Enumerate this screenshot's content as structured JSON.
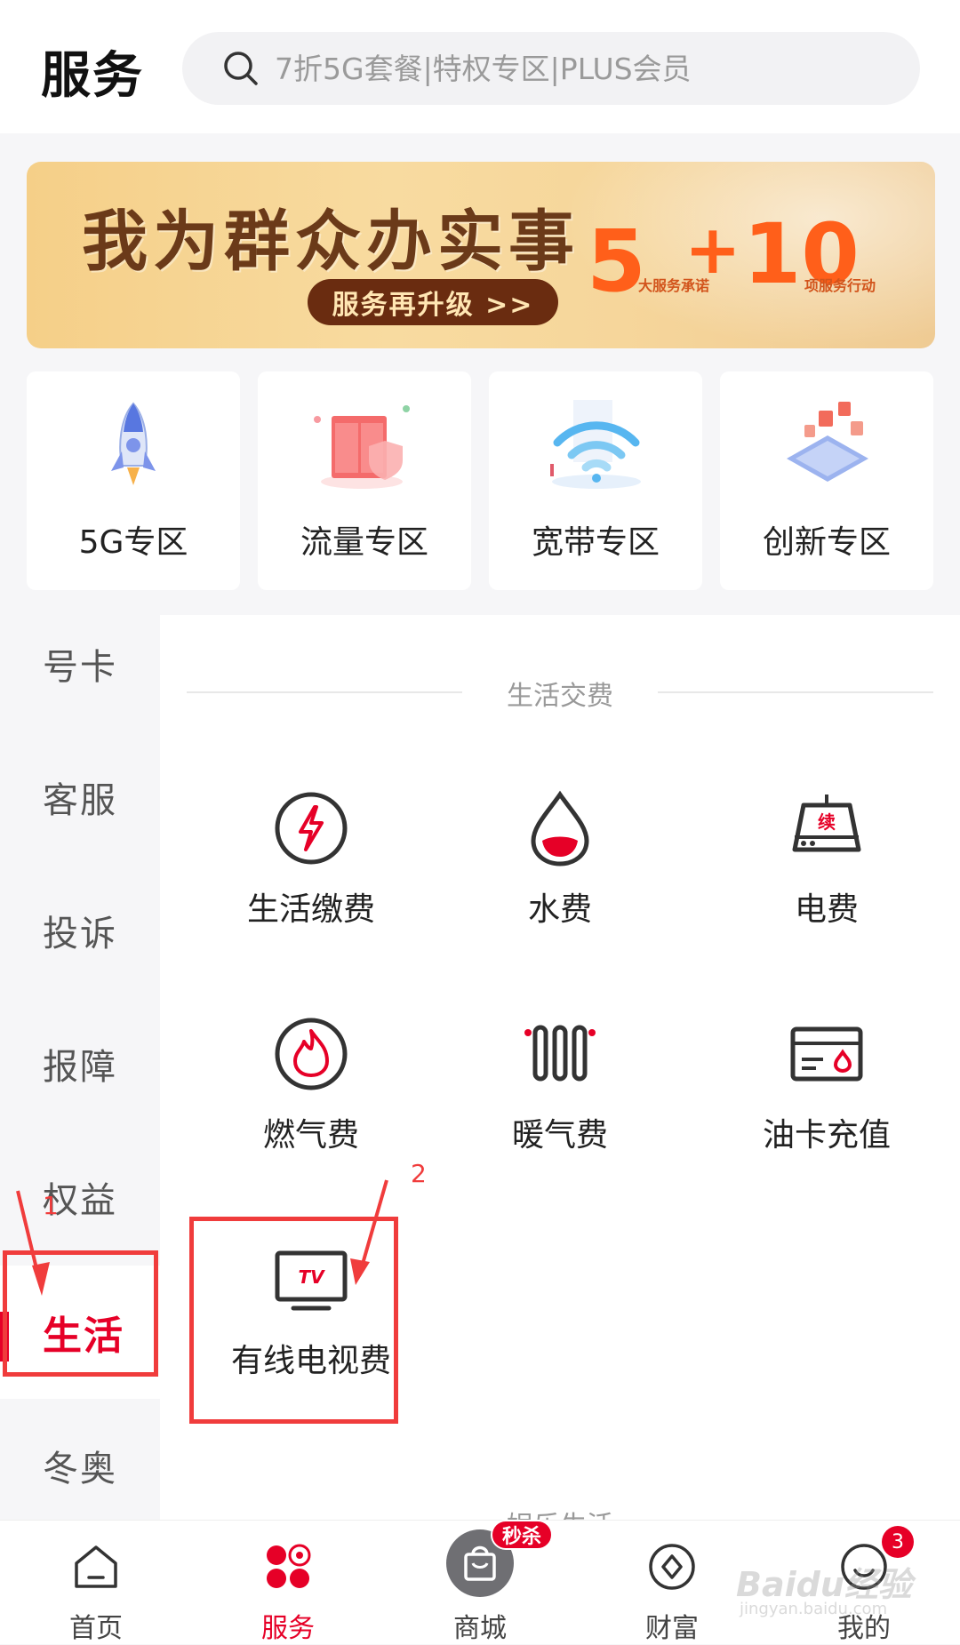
{
  "header": {
    "title": "服务",
    "search_placeholder": "7折5G套餐|特权专区|PLUS会员"
  },
  "banner": {
    "headline": "我为群众办实事",
    "button": "服务再升级 >>",
    "num_a": "5",
    "plus": "+",
    "num_b": "10",
    "small_a": "大服务承诺",
    "small_b": "项服务行动"
  },
  "zones": [
    {
      "label": "5G专区",
      "icon": "rocket-icon"
    },
    {
      "label": "流量专区",
      "icon": "cabinet-shield-icon"
    },
    {
      "label": "宽带专区",
      "icon": "wifi-icon"
    },
    {
      "label": "创新专区",
      "icon": "laptop-icon"
    }
  ],
  "side_nav": {
    "items": [
      "号卡",
      "客服",
      "投诉",
      "报障",
      "权益",
      "生活",
      "冬奥"
    ],
    "active": "生活"
  },
  "sections": {
    "life_payment": "生活交费",
    "entertainment": "娱乐生活"
  },
  "services": [
    {
      "label": "生活缴费",
      "icon": "lightning-circle-icon"
    },
    {
      "label": "水费",
      "icon": "water-drop-icon"
    },
    {
      "label": "电费",
      "icon": "meter-icon",
      "icon_text": "续"
    },
    {
      "label": "燃气费",
      "icon": "flame-circle-icon"
    },
    {
      "label": "暖气费",
      "icon": "radiator-icon"
    },
    {
      "label": "油卡充值",
      "icon": "fuel-card-icon"
    },
    {
      "label": "有线电视费",
      "icon": "tv-icon",
      "icon_text": "TV"
    }
  ],
  "annotations": {
    "step_1": "1",
    "step_2": "2",
    "color": "#f03c3c"
  },
  "tabbar": {
    "items": [
      {
        "label": "首页",
        "icon": "home-icon"
      },
      {
        "label": "服务",
        "icon": "service-grid-icon"
      },
      {
        "label": "商城",
        "icon": "shopping-bag-icon"
      },
      {
        "label": "财富",
        "icon": "wealth-icon"
      },
      {
        "label": "我的",
        "icon": "profile-icon"
      }
    ],
    "active": "服务",
    "sale_badge": "秒杀",
    "mine_badge": "3"
  },
  "watermark": {
    "main": "Baidu经验",
    "sub": "jingyan.baidu.com"
  },
  "colors": {
    "accent": "#e60027",
    "banner_brown": "#6a2c10",
    "banner_orange": "#ff5f1a"
  }
}
